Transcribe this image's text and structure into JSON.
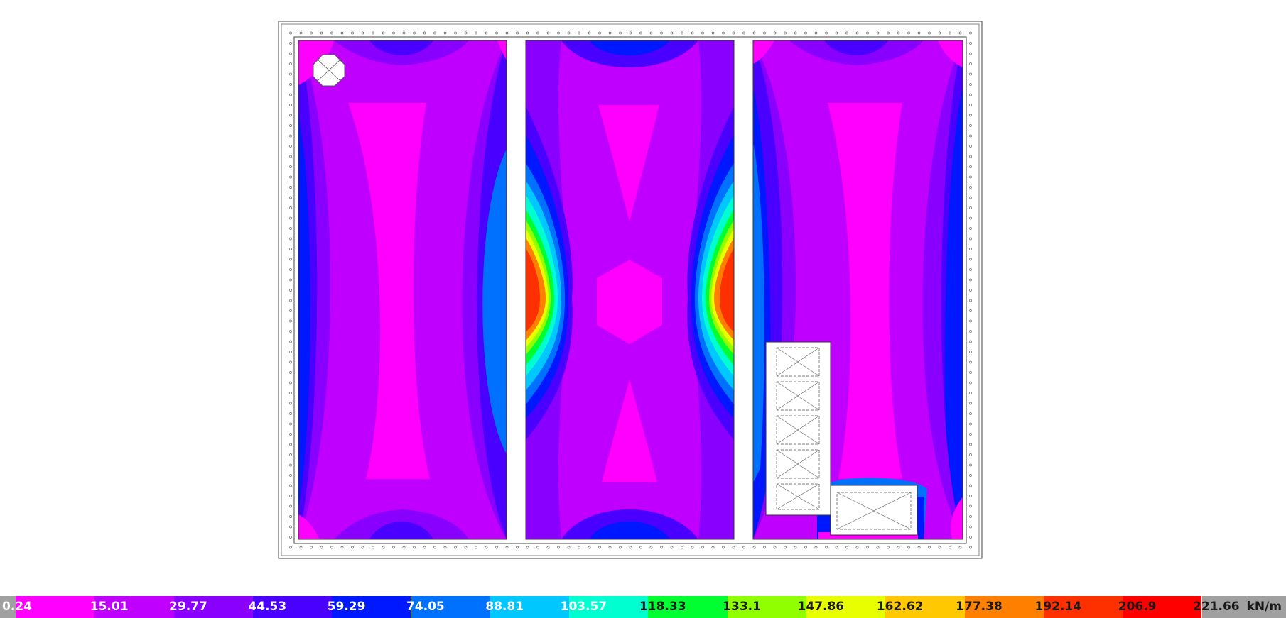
{
  "legend": {
    "unit": "kN/m",
    "ticks": [
      "0.24",
      "15.01",
      "29.77",
      "44.53",
      "59.29",
      "74.05",
      "88.81",
      "103.57",
      "118.33",
      "133.1",
      "147.86",
      "162.62",
      "177.38",
      "192.14",
      "206.9",
      "221.66"
    ],
    "colors": [
      "#a0a0a0",
      "#ff00ff",
      "#c000ff",
      "#8a00ff",
      "#4a00ff",
      "#0018ff",
      "#0070ff",
      "#00c8ff",
      "#00ffd0",
      "#00ff30",
      "#90ff00",
      "#e8ff00",
      "#ffc800",
      "#ff8000",
      "#ff3000",
      "#ff0000",
      "#a0a0a0"
    ]
  },
  "diagram": {
    "colors": {
      "magenta": "#ff00ff",
      "violet": "#c000ff",
      "purple": "#8a00ff",
      "indigo": "#4a00ff",
      "blue": "#0018ff",
      "azure": "#0070ff",
      "cyan": "#00c8ff",
      "aqua": "#00ffd0",
      "green": "#00ff30",
      "lime": "#90ff00",
      "yellow": "#e8ff00",
      "orange": "#ff8000",
      "red": "#ff3000"
    }
  }
}
